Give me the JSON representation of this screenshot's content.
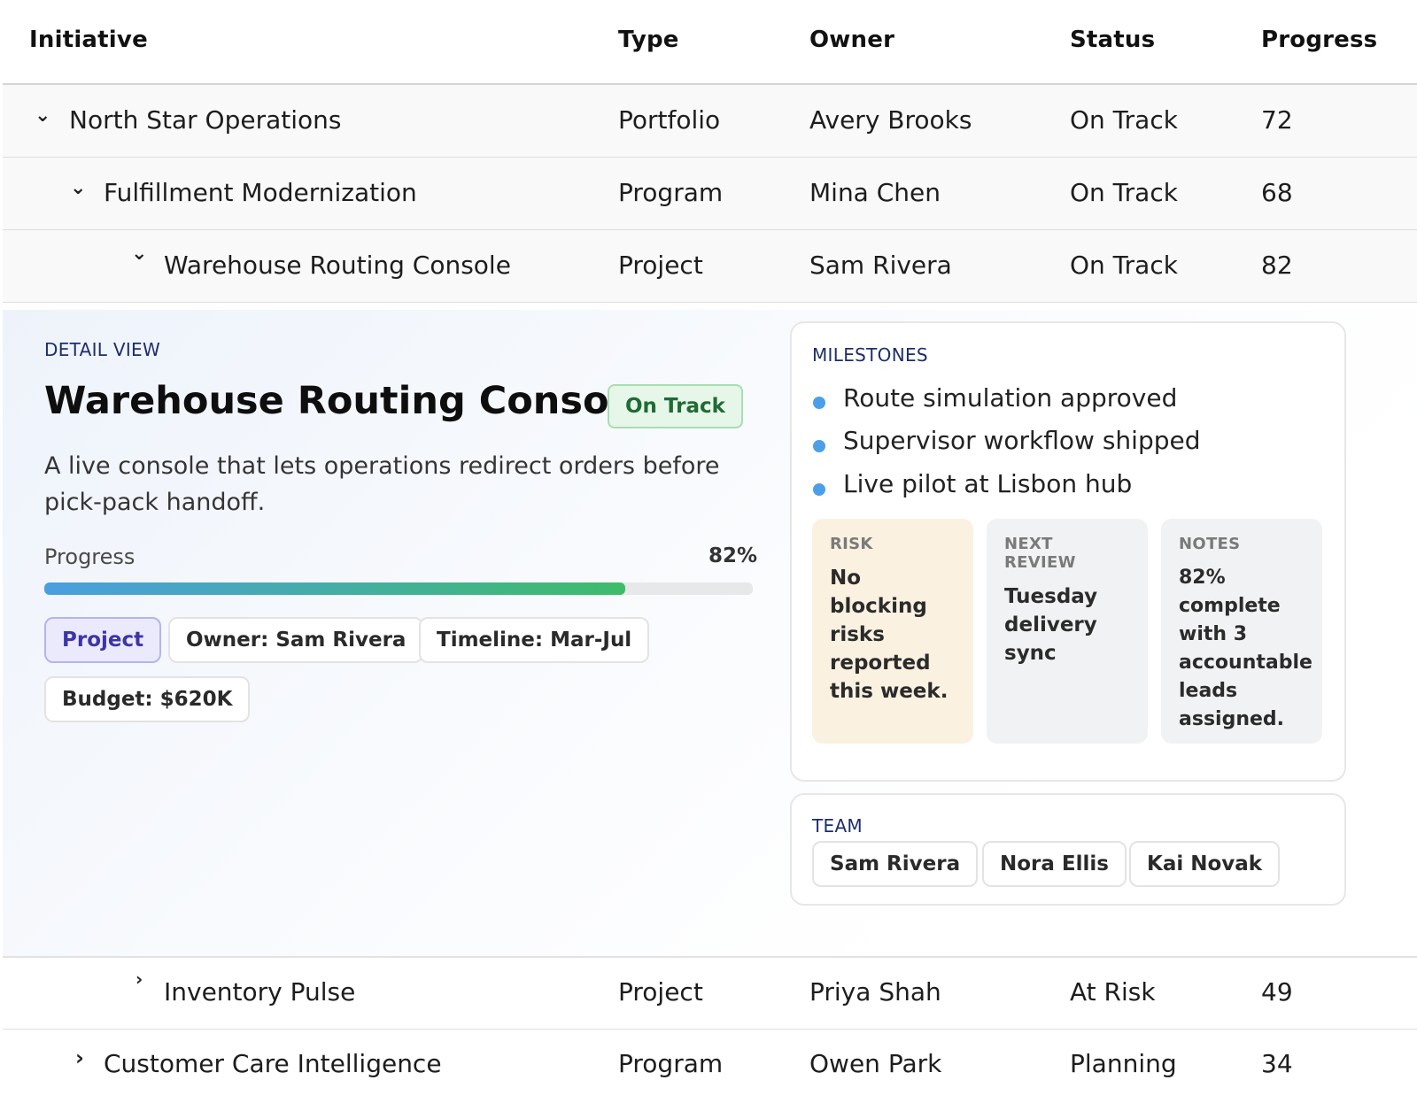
{
  "columns": {
    "initiative": "Initiative",
    "type": "Type",
    "owner": "Owner",
    "status": "Status",
    "progress": "Progress"
  },
  "rows": [
    {
      "name": "North Star Operations",
      "type": "Portfolio",
      "owner": "Avery Brooks",
      "status": "On Track",
      "progress": "72",
      "expanded": true
    },
    {
      "name": "Fulfillment Modernization",
      "type": "Program",
      "owner": "Mina Chen",
      "status": "On Track",
      "progress": "68",
      "expanded": true
    },
    {
      "name": "Warehouse Routing Console",
      "type": "Project",
      "owner": "Sam Rivera",
      "status": "On Track",
      "progress": "82",
      "expanded": true
    },
    {
      "name": "Inventory Pulse",
      "type": "Project",
      "owner": "Priya Shah",
      "status": "At Risk",
      "progress": "49",
      "expanded": false
    },
    {
      "name": "Customer Care Intelligence",
      "type": "Program",
      "owner": "Owen Park",
      "status": "Planning",
      "progress": "34",
      "expanded": false
    }
  ],
  "detail": {
    "section_label": "DETAIL VIEW",
    "title": "Warehouse Routing Console",
    "status_badge": "On Track",
    "description": "A live console that lets operations redirect orders before pick-pack handoff.",
    "progress_label": "Progress",
    "progress_text": "82%",
    "progress_fraction": 0.82,
    "chips": {
      "type": "Project",
      "owner": "Owner: Sam Rivera",
      "timeline": "Timeline: Mar-Jul",
      "budget": "Budget: $620K"
    },
    "milestones": {
      "label": "MILESTONES",
      "items": [
        "Route simulation approved",
        "Supervisor workflow shipped",
        "Live pilot at Lisbon hub"
      ]
    },
    "risk": {
      "label": "RISK",
      "text": "No blocking risks reported this week."
    },
    "next_review": {
      "label": "NEXT REVIEW",
      "text": "Tuesday delivery sync"
    },
    "notes": {
      "label": "NOTES",
      "text": "82% complete with 3 accountable leads assigned."
    },
    "team": {
      "label": "TEAM",
      "members": [
        "Sam Rivera",
        "Nora Ellis",
        "Kai Novak"
      ]
    }
  },
  "colors": {
    "accent_blue": "#4a9fe8",
    "on_track_green": "#1f6b33",
    "project_purple": "#3d34a8",
    "risk_bg": "#faf1e1"
  },
  "icons": {
    "expanded": "chevron-down-icon",
    "collapsed": "chevron-right-icon"
  }
}
